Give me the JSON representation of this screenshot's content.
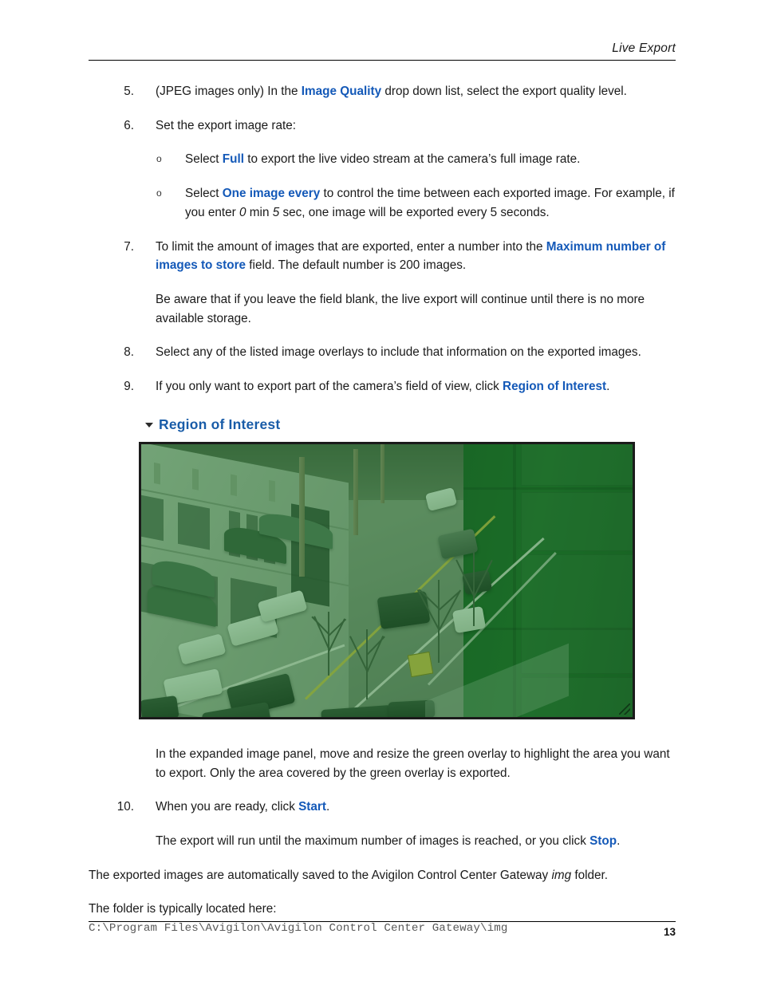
{
  "header": {
    "title": "Live Export",
    "rule": true
  },
  "steps": {
    "s5": {
      "num": "5.",
      "t1": "(JPEG images only) In the ",
      "ui1": "Image Quality",
      "t2": "  drop down list, select the export quality level."
    },
    "s6": {
      "num": "6.",
      "t1": "Set the export image rate:"
    },
    "sub1": {
      "marker": "o",
      "t1": "Select ",
      "ui1": "Full",
      "t2": " to export the live video stream at the camera’s full image rate."
    },
    "sub2": {
      "marker": "o",
      "t1": "Select ",
      "ui1": "One image every",
      "t2": " to control the time between each exported image. For example, if you enter ",
      "it1": "0",
      "t3": " min ",
      "it2": "5",
      "t4": " sec, one image will be exported every 5 seconds."
    },
    "s7": {
      "num": "7.",
      "t1": "To limit the amount of images that are exported, enter a number into the ",
      "ui1": "Maximum number of images to store",
      "t2": " field. The default number is 200 images.",
      "p1": "Be aware that if you leave the field blank, the live export will continue until there is no more available storage."
    },
    "s8": {
      "num": "8.",
      "t1": "Select any of the listed image overlays to include that information on the exported images."
    },
    "s9": {
      "num": "9.",
      "t1": "If you only want to export part of the camera’s field of view, click ",
      "ui1": "Region of Interest",
      "t2": "."
    },
    "s9_caption": "In the expanded image panel, move and resize the green overlay to highlight the area you want to export. Only the area covered by the green overlay is exported.",
    "s10": {
      "num": "10.",
      "t1": "When you are ready, click ",
      "ui1": "Start",
      "t2": ".",
      "p1a": "The export will run until the maximum number of images is reached, or you click ",
      "p1ui": "Stop",
      "p1b": "."
    }
  },
  "figure": {
    "roi_caret_icon": "triangle-down-icon",
    "roi_title": "Region of Interest",
    "resize_grip_icon": "resize-grip-icon",
    "alt": "camera-live-view-with-green-region-of-interest-overlay"
  },
  "closing": {
    "p1a": "The exported images are automatically saved to the Avigilon Control Center Gateway ",
    "p1it": "img",
    "p1b": " folder.",
    "p2": "The folder is typically located here:",
    "path": "C:\\Program Files\\Avigilon\\Avigilon Control Center Gateway\\img"
  },
  "footer": {
    "page_number": "13"
  },
  "colors": {
    "ui_blue": "#1459b8",
    "roi_blue": "#195ca8",
    "text": "#1a1a1a",
    "mono_grey": "#595959",
    "overlay_green": "#167a28"
  }
}
